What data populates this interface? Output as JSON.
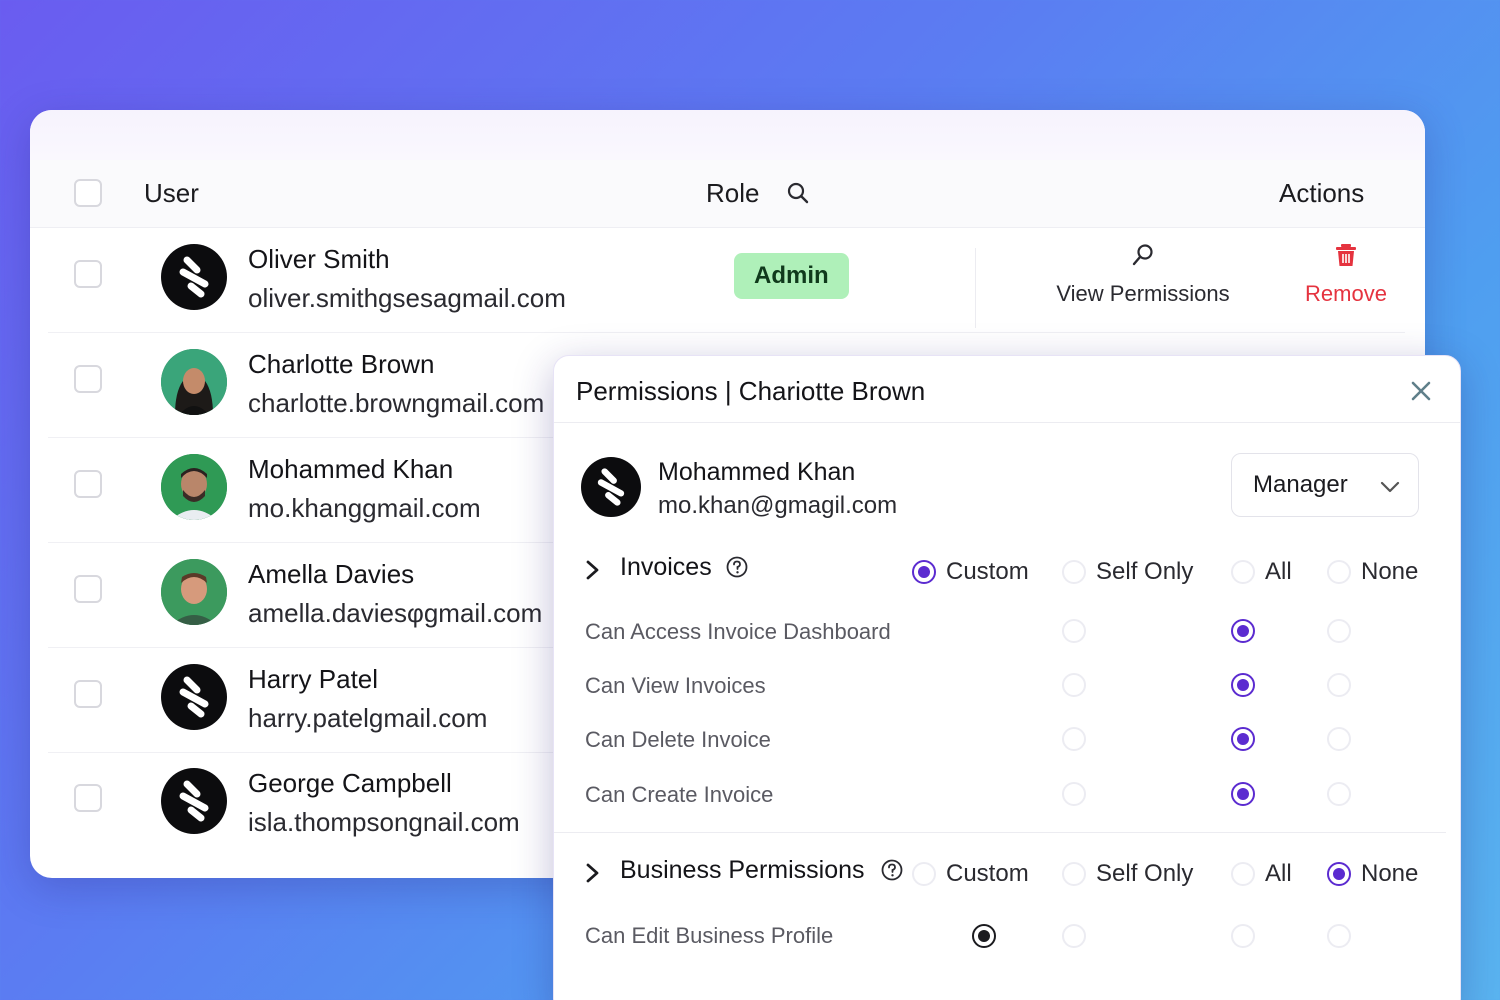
{
  "table": {
    "header": {
      "user": "User",
      "role": "Role",
      "actions": "Actions"
    },
    "rows": [
      {
        "name": "Oliver Smith",
        "email": "oliver.smithgsesagmail.com",
        "role": "Admin",
        "view_permissions": "View Permissions",
        "remove": "Remove",
        "avatar": "logo"
      },
      {
        "name": "Charlotte Brown",
        "email": "charlotte.browngmail.com",
        "avatar": "photo"
      },
      {
        "name": "Mohammed Khan",
        "email": "mo.khanggmail.com",
        "avatar": "photo"
      },
      {
        "name": "Amella Davies",
        "email": "amella.daviesφgmail.com",
        "avatar": "photo"
      },
      {
        "name": "Harry Patel",
        "email": "harry.patelgmail.com",
        "avatar": "logo"
      },
      {
        "name": "George Campbell",
        "email": "isla.thompsongnail.com",
        "avatar": "logo"
      }
    ]
  },
  "modal": {
    "title": "Permissions | Chariotte Brown",
    "user_name": "Mohammed Khan",
    "user_email": "mo.khan@gmagil.com",
    "role_select": {
      "value": "Manager"
    },
    "sections": [
      {
        "title": "Invoices",
        "options": [
          "Custom",
          "Self Only",
          "All",
          "None"
        ],
        "selected": "Custom",
        "permissions": [
          {
            "label": "Can Access Invoice Dashboard",
            "selected": "All"
          },
          {
            "label": "Can View Invoices",
            "selected": "All"
          },
          {
            "label": "Can Delete Invoice",
            "selected": "All"
          },
          {
            "label": "Can Create Invoice",
            "selected": "All"
          }
        ]
      },
      {
        "title": "Business Permissions",
        "options": [
          "Custom",
          "Self Only",
          "All",
          "None"
        ],
        "selected": "None",
        "permissions": [
          {
            "label": "Can Edit Business Profile",
            "selected": "Custom"
          }
        ]
      }
    ]
  },
  "colors": {
    "accent": "#5b2bd0",
    "admin_badge": "#aff0b9",
    "remove": "#e5333f",
    "background_start": "#6a5cf0",
    "background_end": "#5ab4f0"
  },
  "icons": {
    "search": "search-icon",
    "view": "magnifier-icon",
    "remove": "trash-icon",
    "close": "close-icon",
    "help": "help-icon",
    "chevron": "chevron-right-icon",
    "dropdown": "chevron-down-icon"
  }
}
